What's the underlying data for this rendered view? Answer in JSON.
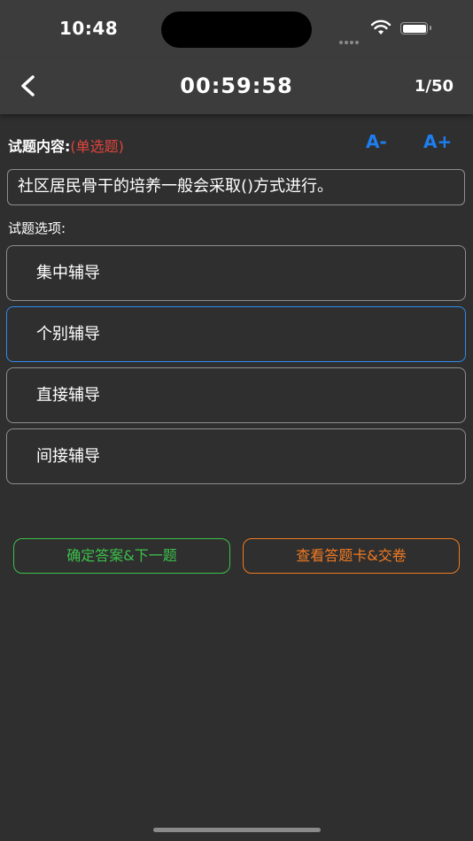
{
  "status_bar": {
    "time": "10:48"
  },
  "nav": {
    "timer": "00:59:58",
    "counter": "1/50"
  },
  "question": {
    "label": "试题内容:",
    "type": "(单选题)",
    "text": "社区居民骨干的培养一般会采取()方式进行。",
    "font_smaller": "A-",
    "font_larger": "A+"
  },
  "options_label": "试题选项:",
  "options": [
    {
      "label": "集中辅导"
    },
    {
      "label": "个别辅导"
    },
    {
      "label": "直接辅导"
    },
    {
      "label": "间接辅导"
    }
  ],
  "selected_option_index": 1,
  "actions": {
    "confirm": "确定答案&下一题",
    "answer_card": "查看答题卡&交卷"
  },
  "colors": {
    "accent_blue": "#1e7ef0",
    "question_type_red": "#e0443c",
    "confirm_green": "#3cc04a",
    "answer_card_orange": "#f07a22"
  }
}
